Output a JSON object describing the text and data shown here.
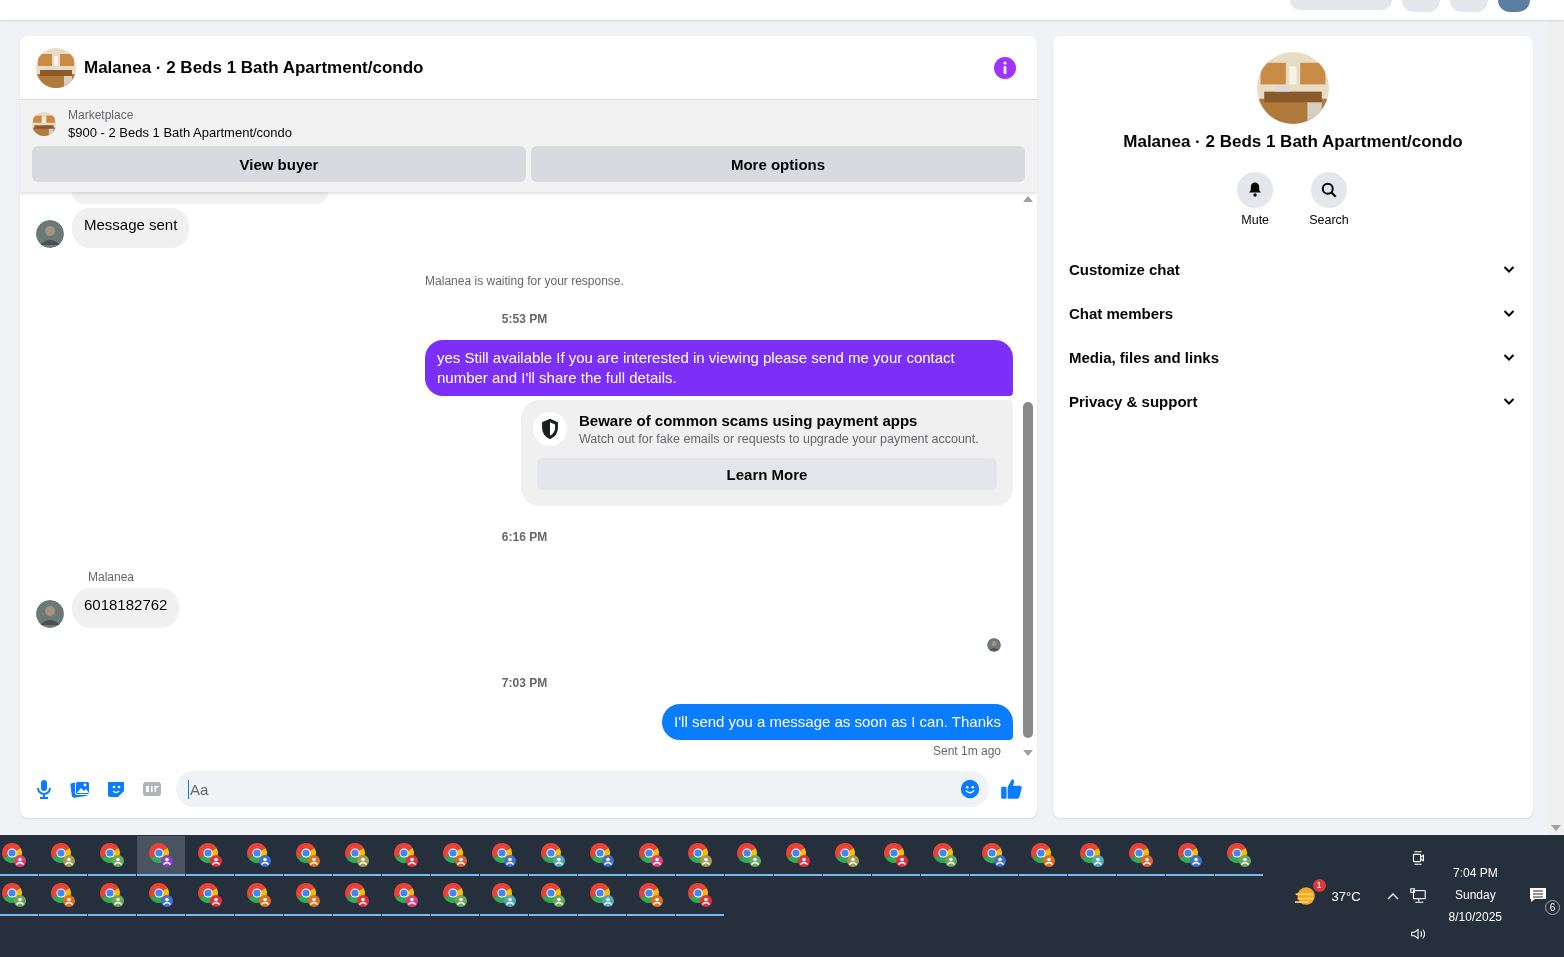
{
  "chat": {
    "title": "Malanea · 2 Beds 1 Bath Apartment/condo",
    "listing": {
      "source": "Marketplace",
      "title": "$900 - 2 Beds 1 Bath Apartment/condo",
      "buttons": [
        "View buyer",
        "More options"
      ]
    },
    "messages": [
      {
        "kind": "clipped"
      },
      {
        "kind": "received",
        "text": "Message sent"
      },
      {
        "kind": "notice",
        "text": "Malanea is waiting for your response."
      },
      {
        "kind": "time",
        "text": "5:53 PM"
      },
      {
        "kind": "sent",
        "text": "yes Still available If you are interested in viewing please send me your contact number and I'll share the full details.",
        "color": "#7b2ff7"
      },
      {
        "kind": "warning",
        "title": "Beware of common scams using payment apps",
        "text": "Watch out for fake emails or requests to upgrade your payment account.",
        "button": "Learn More"
      },
      {
        "kind": "time",
        "text": "6:16 PM"
      },
      {
        "kind": "sender",
        "text": "Malanea"
      },
      {
        "kind": "received",
        "text": "6018182762"
      },
      {
        "kind": "seen"
      },
      {
        "kind": "time",
        "text": "7:03 PM"
      },
      {
        "kind": "sent",
        "text": "I'll send you a message as soon as I can. Thanks",
        "color": "#0a7cff"
      },
      {
        "kind": "status",
        "text": "Sent 1m ago"
      }
    ],
    "composer": {
      "placeholder": "Aa"
    }
  },
  "details": {
    "title": "Malanea · 2 Beds 1 Bath Apartment/condo",
    "actions": [
      {
        "kind": "bell",
        "label": "Mute"
      },
      {
        "kind": "search",
        "label": "Search"
      }
    ],
    "sections": [
      {
        "label": "Customize chat",
        "expanded": false
      },
      {
        "label": "Chat members",
        "expanded": false
      },
      {
        "label": "Media, files and links",
        "expanded": false
      },
      {
        "label": "Privacy & support",
        "expanded": false
      }
    ]
  },
  "taskbar": {
    "rows": [
      [
        {
          "color": "#e0407a",
          "selected": false
        },
        {
          "color": "#a89a50",
          "selected": false
        },
        {
          "color": "#6aa860",
          "selected": false
        },
        {
          "color": "#8a3fd0",
          "selected": true
        },
        {
          "color": "#e03040",
          "selected": false
        },
        {
          "color": "#4070d0",
          "selected": false
        },
        {
          "color": "#e07020",
          "selected": false
        },
        {
          "color": "#a89a50",
          "selected": false
        },
        {
          "color": "#e03040",
          "selected": false
        },
        {
          "color": "#e06030",
          "selected": false
        },
        {
          "color": "#4070d0",
          "selected": false
        },
        {
          "color": "#50a8b8",
          "selected": false
        },
        {
          "color": "#4070d0",
          "selected": false
        },
        {
          "color": "#e0407a",
          "selected": false
        },
        {
          "color": "#a89a50",
          "selected": false
        },
        {
          "color": "#6aa860",
          "selected": false
        },
        {
          "color": "#e03040",
          "selected": false
        },
        {
          "color": "#a89a50",
          "selected": false
        },
        {
          "color": "#e03040",
          "selected": false
        },
        {
          "color": "#6aa860",
          "selected": false
        },
        {
          "color": "#4070d0",
          "selected": false
        },
        {
          "color": "#e07020",
          "selected": false
        },
        {
          "color": "#50a8b8",
          "selected": false
        },
        {
          "color": "#e06030",
          "selected": false
        },
        {
          "color": "#4070d0",
          "selected": false
        },
        {
          "color": "#6aa860",
          "selected": false
        }
      ],
      [
        {
          "color": "#6aa860",
          "selected": false
        },
        {
          "color": "#e07020",
          "selected": false
        },
        {
          "color": "#6aa860",
          "selected": false
        },
        {
          "color": "#4070d0",
          "selected": false
        },
        {
          "color": "#e03040",
          "selected": false
        },
        {
          "color": "#e07020",
          "selected": false
        },
        {
          "color": "#e07020",
          "selected": false
        },
        {
          "color": "#e03040",
          "selected": false
        },
        {
          "color": "#e0407a",
          "selected": false
        },
        {
          "color": "#6aa860",
          "selected": false
        },
        {
          "color": "#50a8b8",
          "selected": false
        },
        {
          "color": "#6aa860",
          "selected": false
        },
        {
          "color": "#50a8b8",
          "selected": false
        },
        {
          "color": "#e07020",
          "selected": false
        },
        {
          "color": "#e03040",
          "selected": false
        }
      ]
    ],
    "weather": {
      "temperature": "37°C",
      "badge": "1"
    },
    "clock": {
      "time": "7:04 PM",
      "day": "Sunday",
      "date": "8/10/2025"
    },
    "notifications": {
      "count": "6"
    }
  }
}
